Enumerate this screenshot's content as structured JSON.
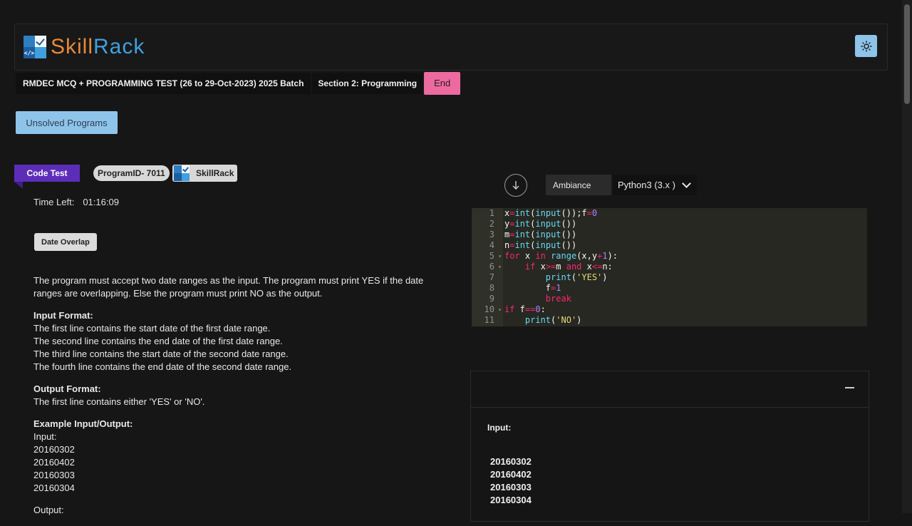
{
  "brand": {
    "logo_text_a": "Skill",
    "logo_text_b": "Rack",
    "logo_mark_text": "</>"
  },
  "header": {
    "theme_icon": "sun-icon"
  },
  "testbar": {
    "test_title": "RMDEC MCQ + PROGRAMMING TEST (26 to 29-Oct-2023) 2025 Batch",
    "section_title": "Section 2: Programming",
    "end_label": "End"
  },
  "unsolved_label": "Unsolved Programs",
  "tags": {
    "code_test": "Code Test",
    "program_id": "ProgramID- 7011",
    "skillrack": "SkillRack"
  },
  "timer": {
    "label": "Time Left:",
    "value": "01:16:09"
  },
  "program_name": "Date Overlap",
  "description": {
    "intro": "The program must accept two date ranges as the input. The program must print YES if the date ranges are overlapping. Else the program must print NO as the output.",
    "input_format_heading": "Input Format:",
    "input_format_lines": [
      "The first line contains the start date of the first date range.",
      "The second line contains the end date of the first date range.",
      "The third line contains the start date of the second date range.",
      "The fourth line contains the end date of the second date range."
    ],
    "output_format_heading": "Output Format:",
    "output_format_line": "The first line contains either 'YES' or 'NO'.",
    "example_heading": "Example Input/Output:",
    "example_input_label": "Input:",
    "example_input_values": [
      "20160302",
      "20160402",
      "20160303",
      "20160304"
    ],
    "example_output_label": "Output:"
  },
  "editor_toolbar": {
    "download_icon": "download-icon",
    "theme": "Ambiance",
    "language": "Python3 (3.x )"
  },
  "code_lines": [
    "x=int(input());f=0",
    "y=int(input())",
    "m=int(input())",
    "n=int(input())",
    "for x in range(x,y+1):",
    "    if x>=m and x<=n:",
    "        print('YES')",
    "        f=1",
    "        break",
    "if f==0:",
    "    print('NO')"
  ],
  "line_numbers": [
    "1",
    "2",
    "3",
    "4",
    "5",
    "6",
    "7",
    "8",
    "9",
    "10",
    "11"
  ],
  "output_panel": {
    "input_label": "Input:",
    "input_values": [
      "20160302",
      "20160402",
      "20160303",
      "20160304"
    ]
  }
}
